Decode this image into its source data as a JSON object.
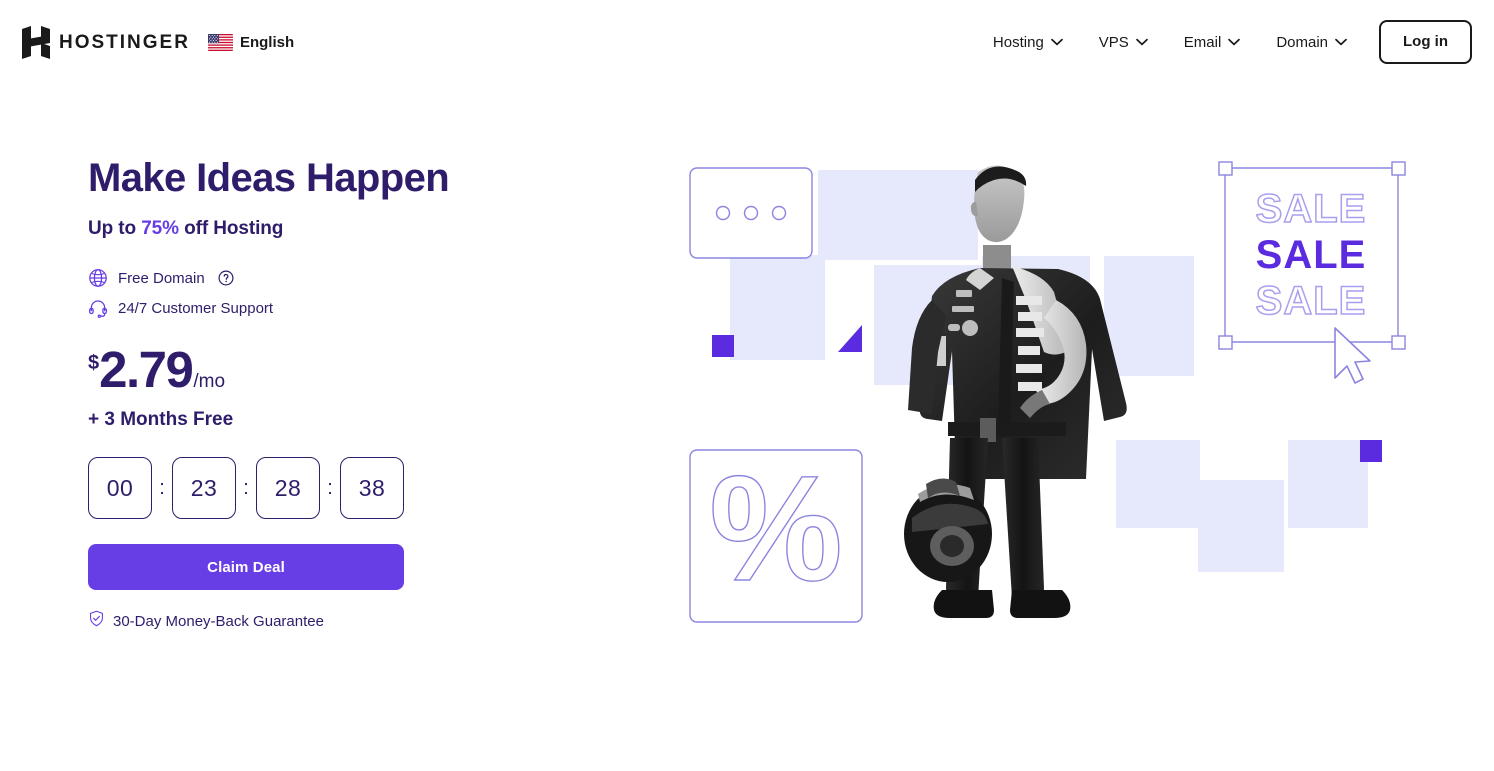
{
  "header": {
    "logo": {
      "icon": "hostinger-h-logo",
      "wordmark": "HOSTINGER"
    },
    "language": {
      "icon": "us-flag-icon",
      "label": "English"
    },
    "nav_items": [
      {
        "label": "Hosting",
        "icon": "chevron-down-icon"
      },
      {
        "label": "VPS",
        "icon": "chevron-down-icon"
      },
      {
        "label": "Email",
        "icon": "chevron-down-icon"
      },
      {
        "label": "Domain",
        "icon": "chevron-down-icon"
      }
    ],
    "login_label": "Log in"
  },
  "hero": {
    "title": "Make Ideas Happen",
    "subtitle_pre": "Up to ",
    "subtitle_accent": "75%",
    "subtitle_post": " off Hosting",
    "features": [
      {
        "icon": "globe-icon",
        "label": "Free Domain",
        "help_icon": "question-circle-icon"
      },
      {
        "icon": "headset-icon",
        "label": "24/7 Customer Support"
      }
    ],
    "price": {
      "currency": "$",
      "amount": "2.79",
      "period": "/mo"
    },
    "bonus": "+ 3 Months Free",
    "countdown": {
      "days": "00",
      "hours": "23",
      "minutes": "28",
      "seconds": "38",
      "separator": ":"
    },
    "cta_label": "Claim Deal",
    "guarantee": {
      "icon": "shield-check-icon",
      "label": "30-Day Money-Back Guarantee"
    }
  },
  "illustration": {
    "dots_card": {
      "name": "three-dots-card",
      "dots": 3
    },
    "percent_card": {
      "name": "percent-card",
      "glyph": "%"
    },
    "sale_block": {
      "name": "sale-selection-box",
      "lines": [
        "SALE",
        "SALE",
        "SALE"
      ],
      "cursor_icon": "mouse-cursor-icon"
    },
    "photo": {
      "name": "racing-driver-photo",
      "alt": "Racing driver holding helmet"
    }
  },
  "colors": {
    "brand_purple": "#673de6",
    "deep_purple": "#2f1c6a",
    "light_lavender": "#e5e9fb",
    "outline_purple": "#8c85e0",
    "ink": "#1a1a1a"
  }
}
